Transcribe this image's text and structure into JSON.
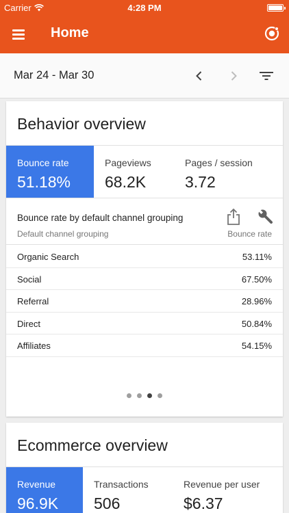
{
  "status_bar": {
    "carrier": "Carrier",
    "time": "4:28 PM"
  },
  "app_bar": {
    "title": "Home",
    "accent_color": "#e8541d"
  },
  "date_bar": {
    "range": "Mar 24 - Mar 30"
  },
  "behavior": {
    "title": "Behavior overview",
    "metrics": [
      {
        "label": "Bounce rate",
        "value": "51.18%"
      },
      {
        "label": "Pageviews",
        "value": "68.2K"
      },
      {
        "label": "Pages / session",
        "value": "3.72"
      }
    ],
    "table": {
      "title": "Bounce rate by default channel grouping",
      "dimension_label": "Default channel grouping",
      "metric_label": "Bounce rate",
      "rows": [
        {
          "name": "Organic Search",
          "value": "53.11%"
        },
        {
          "name": "Social",
          "value": "67.50%"
        },
        {
          "name": "Referral",
          "value": "28.96%"
        },
        {
          "name": "Direct",
          "value": "50.84%"
        },
        {
          "name": "Affiliates",
          "value": "54.15%"
        }
      ]
    },
    "pager": {
      "total": 4,
      "active_index": 2
    }
  },
  "ecommerce": {
    "title": "Ecommerce overview",
    "metrics": [
      {
        "label": "Revenue",
        "value": "96.9K"
      },
      {
        "label": "Transactions",
        "value": "506"
      },
      {
        "label": "Revenue per user",
        "value": "$6.37"
      }
    ]
  },
  "icons": {
    "menu": "menu-icon",
    "account": "account-switcher-icon",
    "prev": "chevron-left-icon",
    "next": "chevron-right-icon",
    "filter": "filter-icon",
    "share": "share-icon",
    "tool": "wrench-icon"
  },
  "colors": {
    "active_metric": "#3b78e7"
  }
}
